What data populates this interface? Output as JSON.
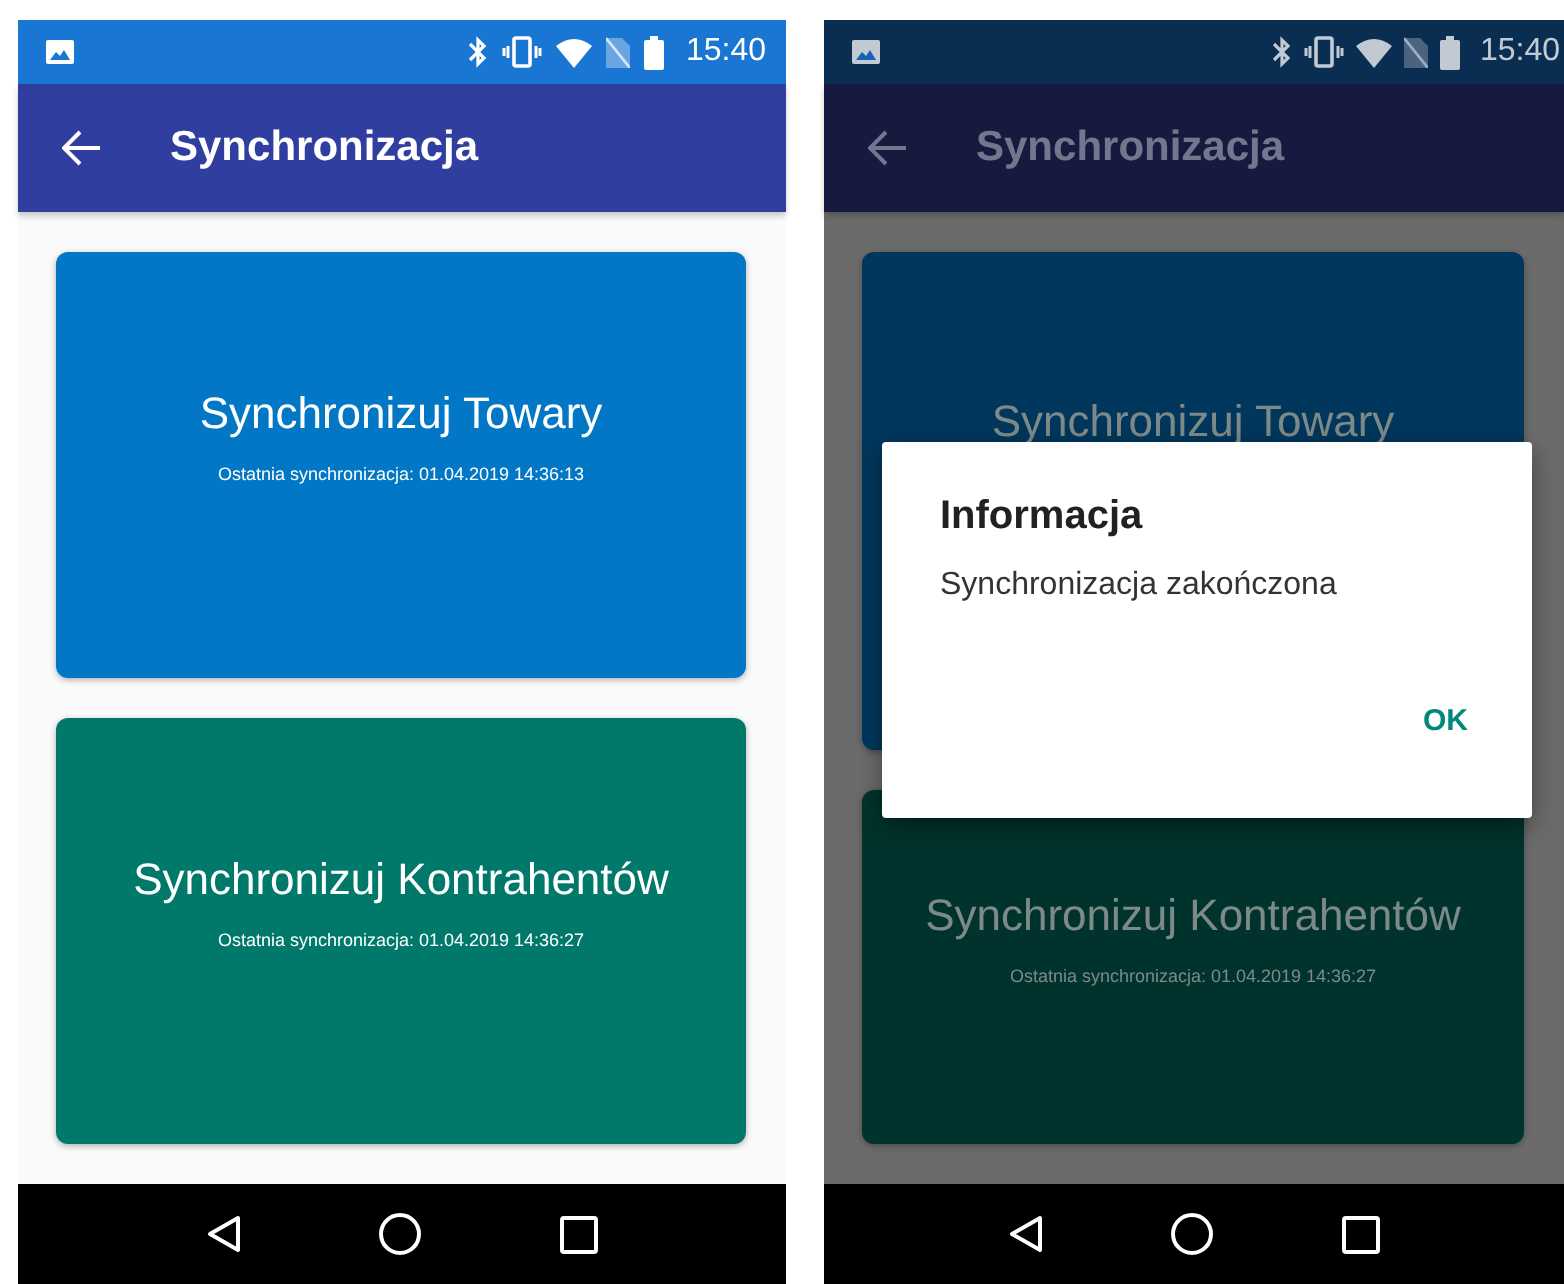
{
  "screens": [
    {
      "status_time": "15:40",
      "title": "Synchronizacja",
      "cards": [
        {
          "title": "Synchronizuj Towary",
          "subtitle": "Ostatnia synchronizacja: 01.04.2019 14:36:13",
          "color": "#0277c6"
        },
        {
          "title": "Synchronizuj Kontrahentów",
          "subtitle": "Ostatnia synchronizacja: 01.04.2019 14:36:27",
          "color": "#00796b"
        }
      ]
    },
    {
      "status_time": "15:40",
      "title": "Synchronizacja",
      "cards": [
        {
          "title": "Synchronizuj Towary",
          "color": "#01375c"
        },
        {
          "title": "Synchronizuj Kontrahentów",
          "subtitle": "Ostatnia synchronizacja: 01.04.2019 14:36:27",
          "color": "#00332d"
        }
      ],
      "dialog": {
        "title": "Informacja",
        "message": "Synchronizacja zakończona",
        "button": "OK"
      }
    }
  ]
}
